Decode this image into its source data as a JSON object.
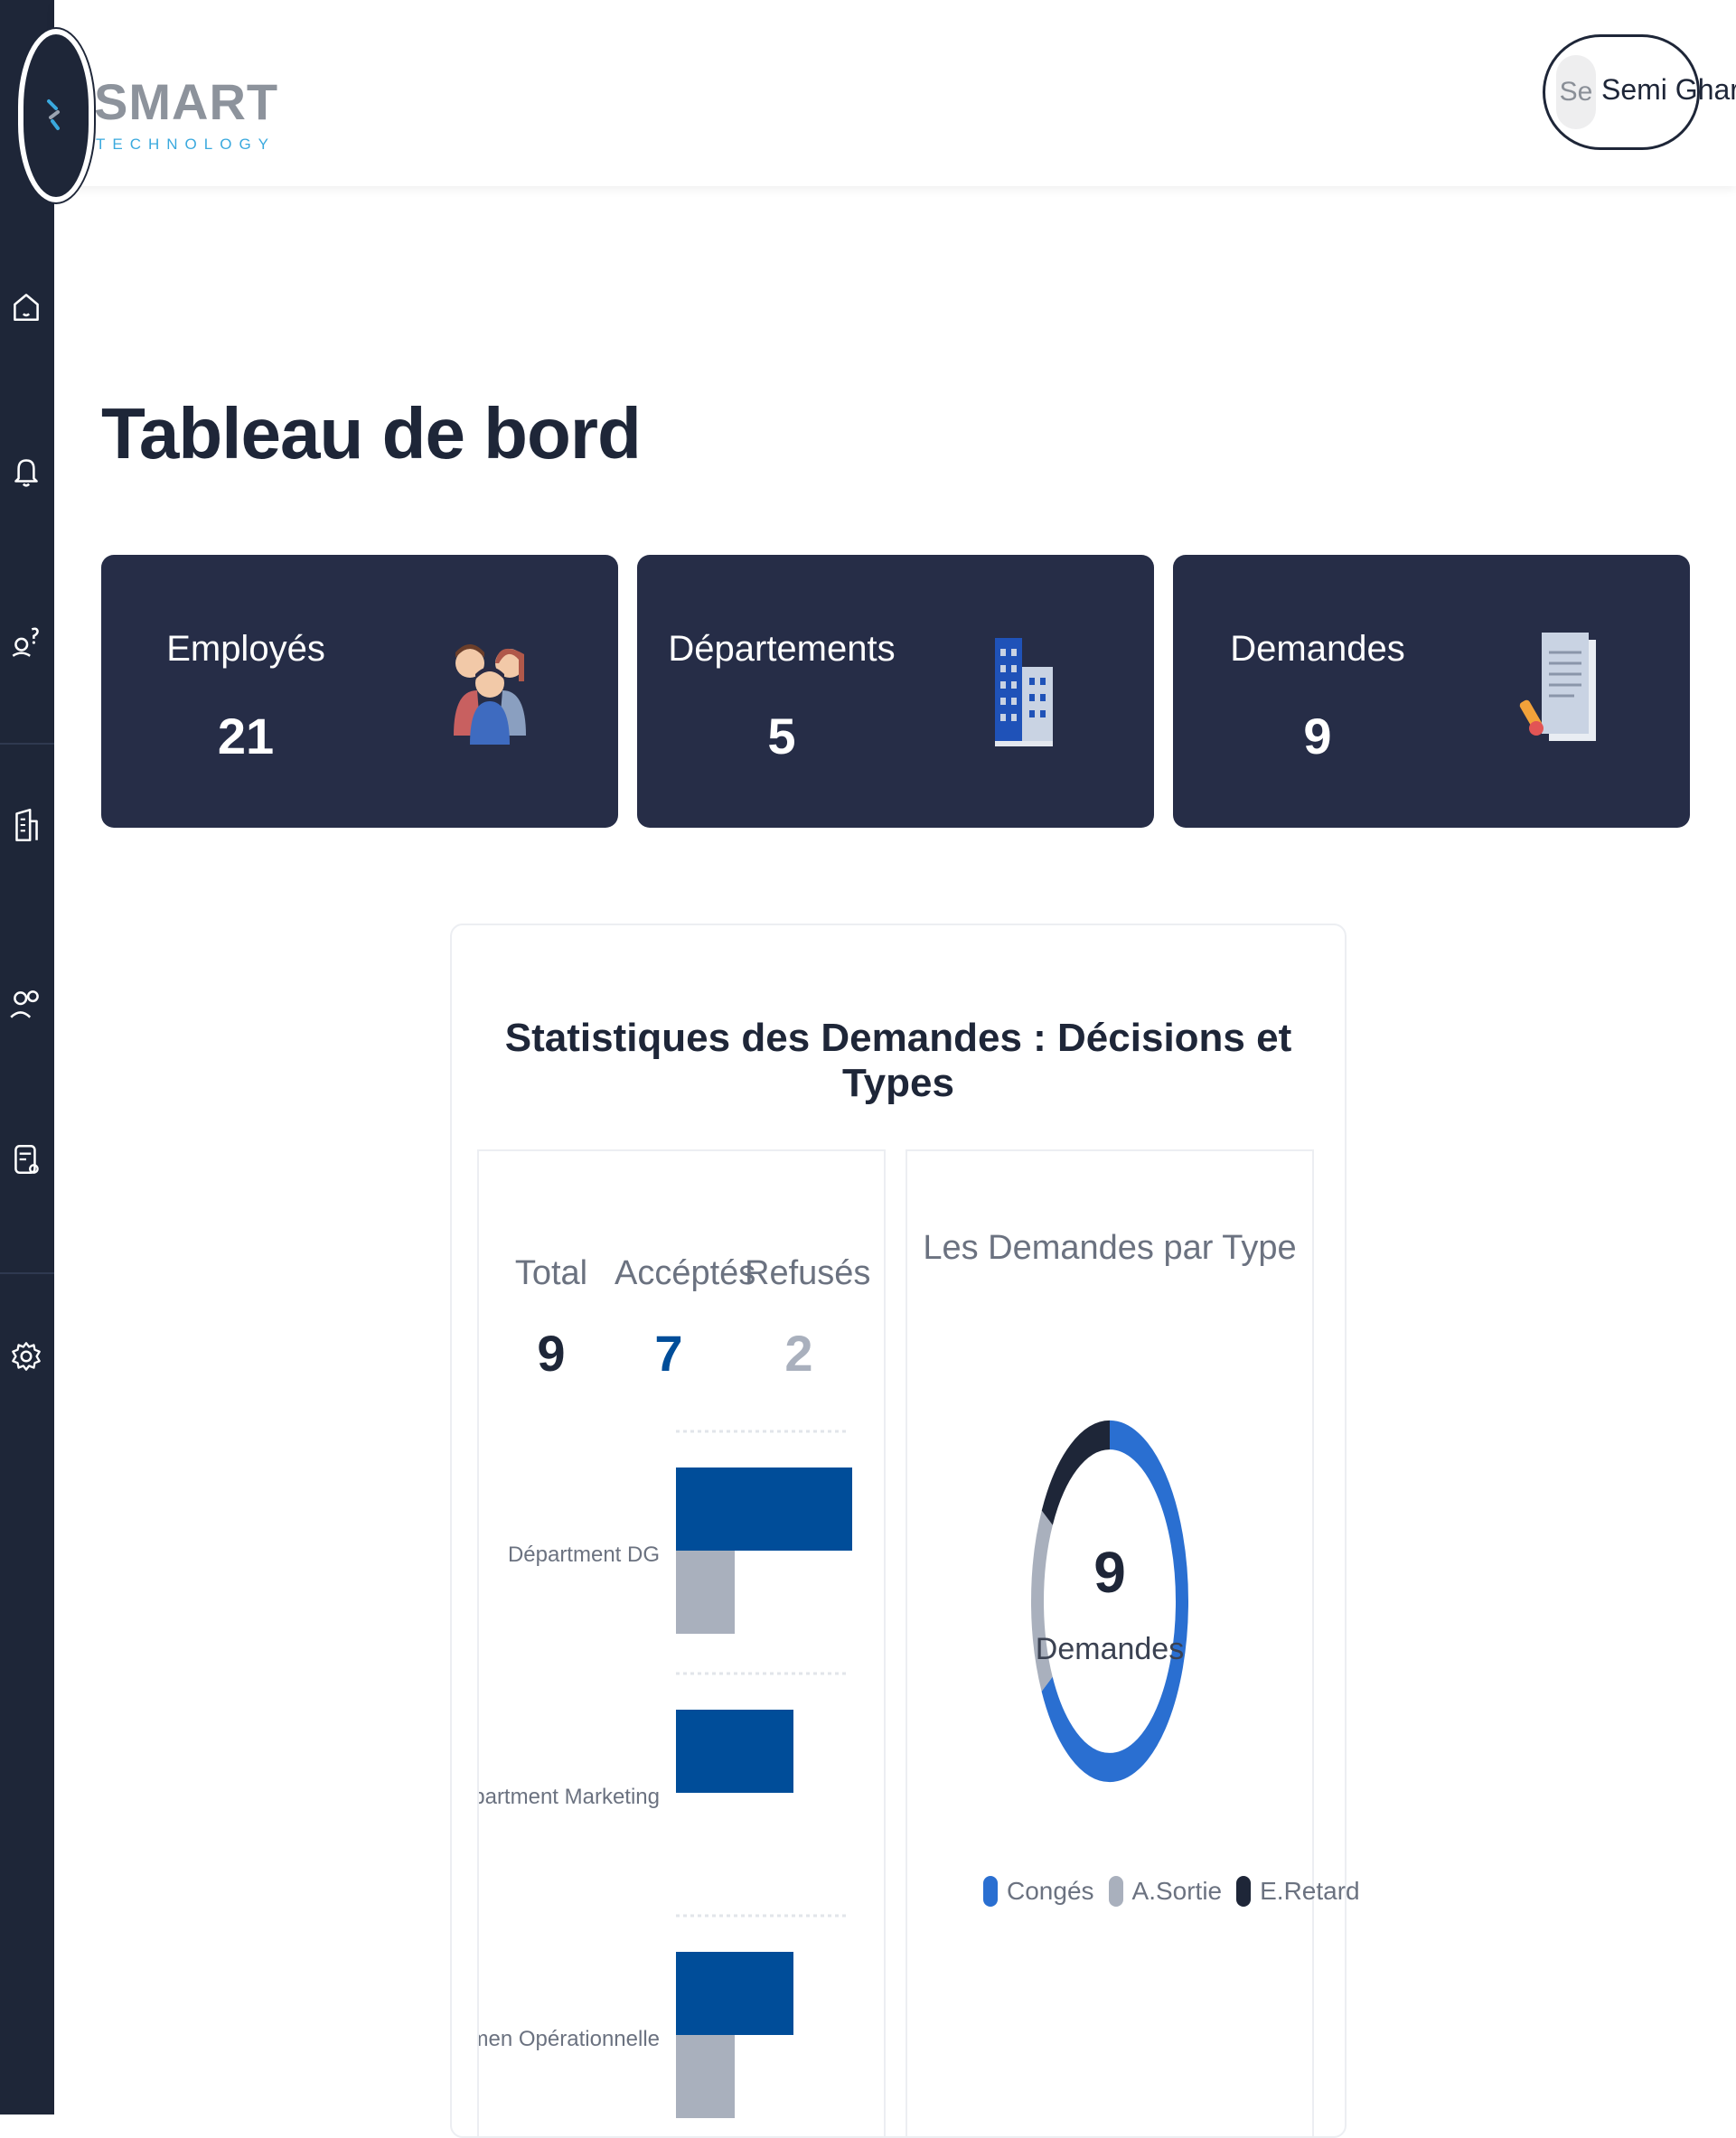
{
  "brand": {
    "name": "SMART",
    "tagline": "TECHNOLOGY"
  },
  "user": {
    "initials": "Se",
    "name": "Semi Gharbi"
  },
  "page": {
    "title": "Tableau de bord"
  },
  "cards": [
    {
      "label": "Employés",
      "value": "21",
      "icon": "employees-icon"
    },
    {
      "label": "Départements",
      "value": "5",
      "icon": "building-icon"
    },
    {
      "label": "Demandes",
      "value": "9",
      "icon": "document-icon"
    }
  ],
  "stats": {
    "title": "Statistiques des Demandes : Décisions et Types",
    "total_label": "Total",
    "total_value": "9",
    "accepted_label": "Accéptés",
    "accepted_value": "7",
    "refused_label": "Refusés",
    "refused_value": "2"
  },
  "donut": {
    "title": "Les Demandes par Type",
    "center_value": "9",
    "center_label": "Demandes",
    "legend": [
      {
        "label": "Congés",
        "color": "#2a6fd1"
      },
      {
        "label": "A.Sortie",
        "color": "#a9b0bd"
      },
      {
        "label": "E.Retard",
        "color": "#1e2638"
      }
    ]
  },
  "colors": {
    "accepted": "#004d99",
    "refused": "#a9b0bd",
    "sidebar": "#1e2638",
    "card": "#262d47"
  },
  "chart_data": [
    {
      "type": "bar",
      "orientation": "horizontal",
      "categories": [
        "Départment DG",
        "Départment Marketing",
        "Départmen Opérationnelle"
      ],
      "series": [
        {
          "values": [
            3,
            2,
            2
          ]
        },
        {
          "values": [
            1,
            0,
            1
          ]
        }
      ],
      "grid": true
    },
    {
      "type": "pie",
      "style": "donut",
      "labels": [
        "Congés",
        "A.Sortie",
        "E.Retard"
      ],
      "values": [
        6,
        1.5,
        1.5
      ]
    }
  ]
}
